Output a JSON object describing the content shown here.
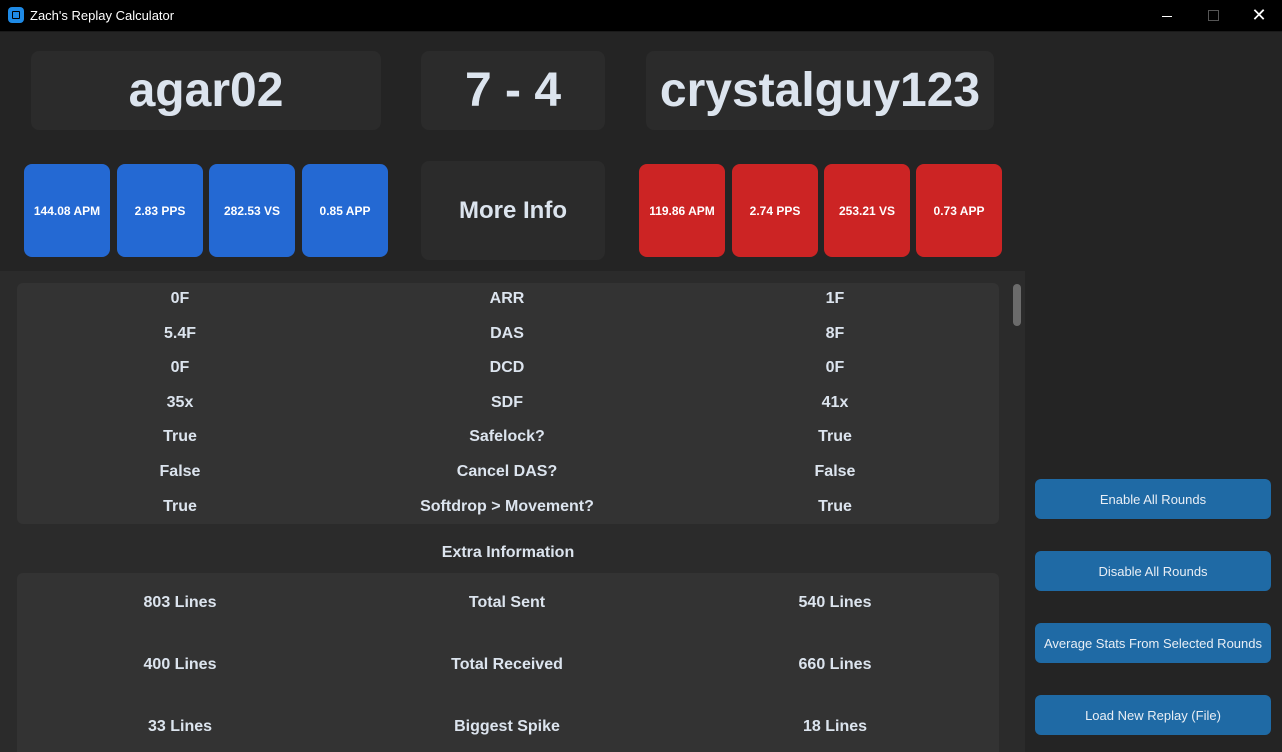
{
  "window": {
    "title": "Zach's Replay Calculator",
    "minimize": "",
    "maximize": "",
    "close": "✕"
  },
  "header": {
    "player_left": "agar02",
    "score": "7 - 4",
    "player_right": "crystalguy123",
    "more_info": "More Info"
  },
  "stats_left": [
    "144.08 APM",
    "2.83 PPS",
    "282.53 VS",
    "0.85 APP"
  ],
  "stats_right": [
    "119.86 APM",
    "2.74 PPS",
    "253.21 VS",
    "0.73 APP"
  ],
  "settings": [
    {
      "left": "0F",
      "label": "ARR",
      "right": "1F"
    },
    {
      "left": "5.4F",
      "label": "DAS",
      "right": "8F"
    },
    {
      "left": "0F",
      "label": "DCD",
      "right": "0F"
    },
    {
      "left": "35x",
      "label": "SDF",
      "right": "41x"
    },
    {
      "left": "True",
      "label": "Safelock?",
      "right": "True"
    },
    {
      "left": "False",
      "label": "Cancel DAS?",
      "right": "False"
    },
    {
      "left": "True",
      "label": "Softdrop > Movement?",
      "right": "True"
    }
  ],
  "extra": {
    "title": "Extra Information",
    "rows": [
      {
        "left": "803 Lines",
        "label": "Total Sent",
        "right": "540 Lines"
      },
      {
        "left": "400 Lines",
        "label": "Total Received",
        "right": "660 Lines"
      },
      {
        "left": "33 Lines",
        "label": "Biggest Spike",
        "right": "18 Lines"
      }
    ]
  },
  "side_buttons": [
    "Enable All Rounds",
    "Disable All Rounds",
    "Average Stats From Selected Rounds",
    "Load New Replay (File)"
  ],
  "colors": {
    "blue_stat": "#2469d3",
    "red_stat": "#cc2424",
    "side_button": "#1f6aa5",
    "background": "#242424"
  }
}
